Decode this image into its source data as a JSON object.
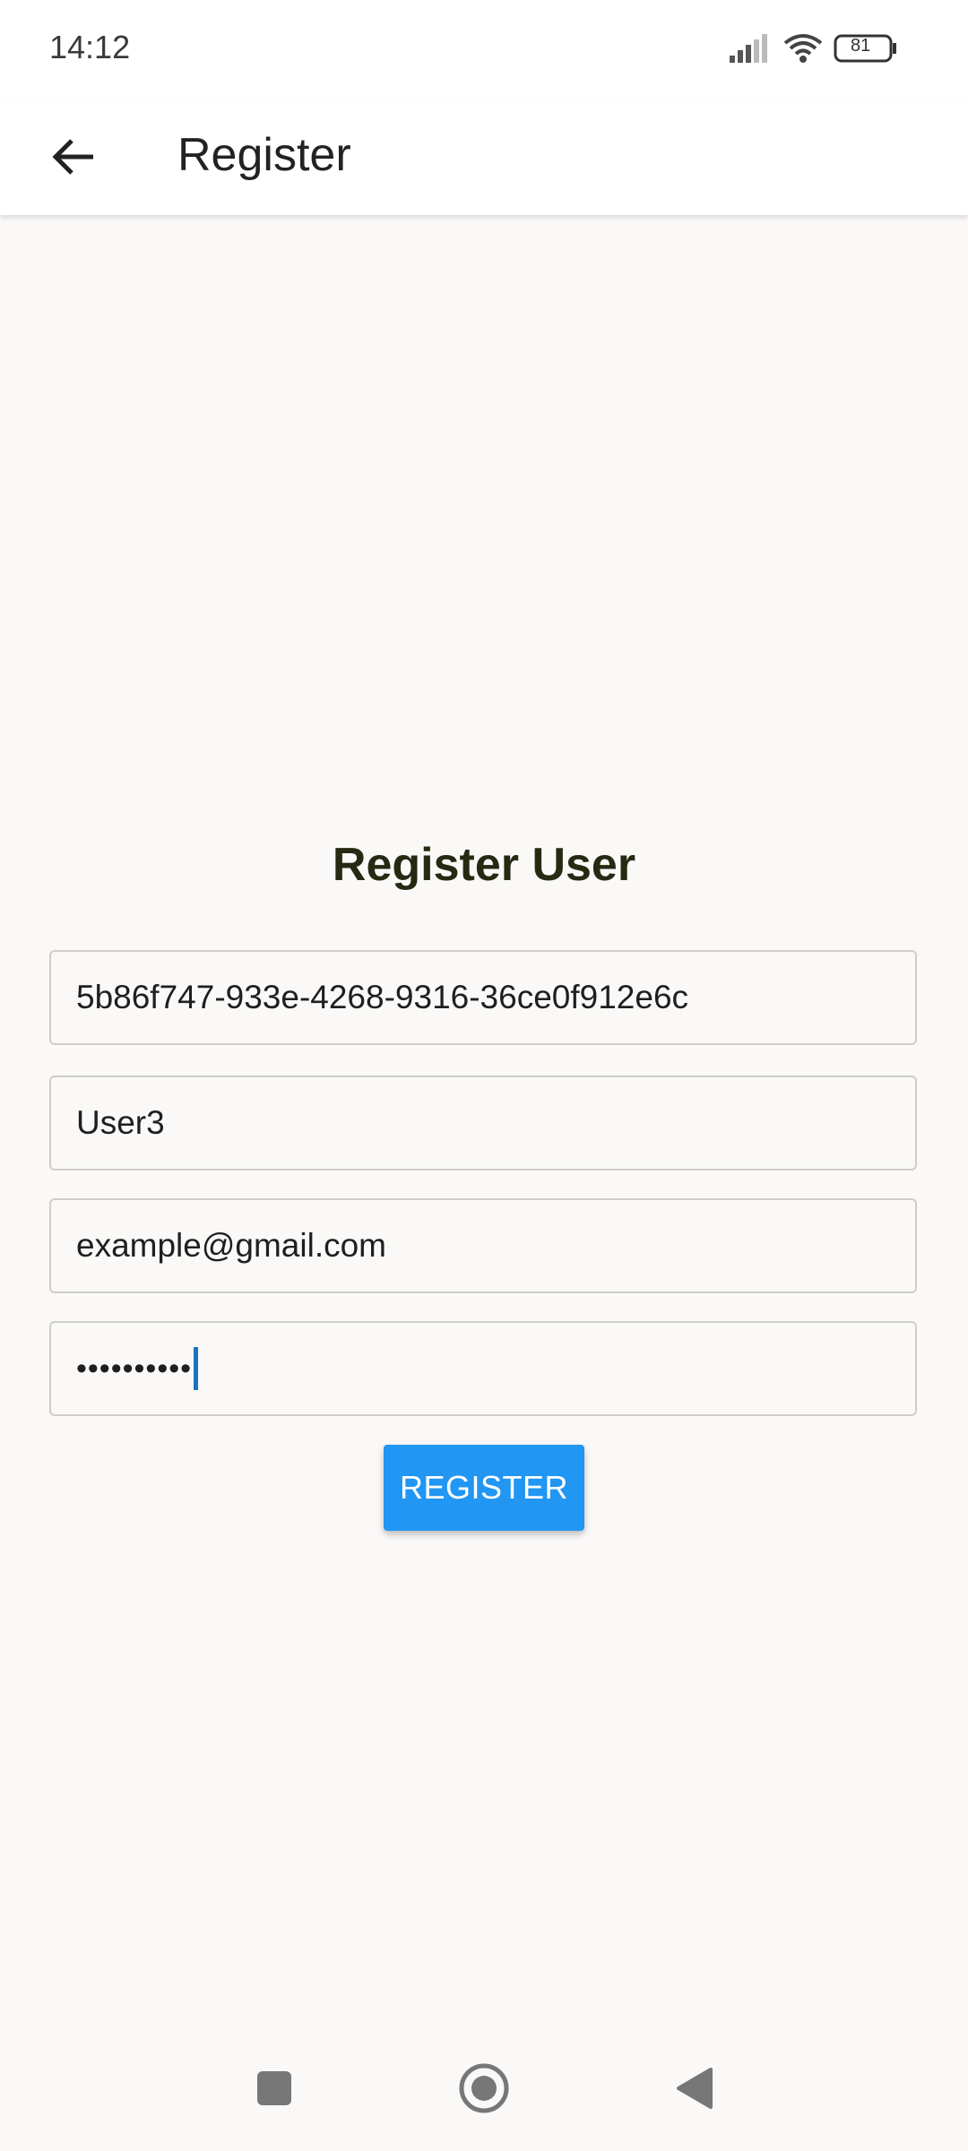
{
  "status_bar": {
    "time": "14:12",
    "battery": "81"
  },
  "app_bar": {
    "title": "Register",
    "back_icon": "arrow-left-icon"
  },
  "form": {
    "title": "Register User",
    "fields": [
      {
        "name": "id",
        "value": "5b86f747-933e-4268-9316-36ce0f912e6c"
      },
      {
        "name": "username",
        "value": "User3"
      },
      {
        "name": "email",
        "value": "example@gmail.com"
      },
      {
        "name": "password",
        "value": "••••••••••"
      }
    ],
    "button_label": "REGISTER"
  },
  "colors": {
    "accent": "#2196f3",
    "title": "#262a12",
    "background": "#faf9f8"
  },
  "nav_icons": [
    "square-recents-icon",
    "circle-home-icon",
    "triangle-back-icon"
  ]
}
